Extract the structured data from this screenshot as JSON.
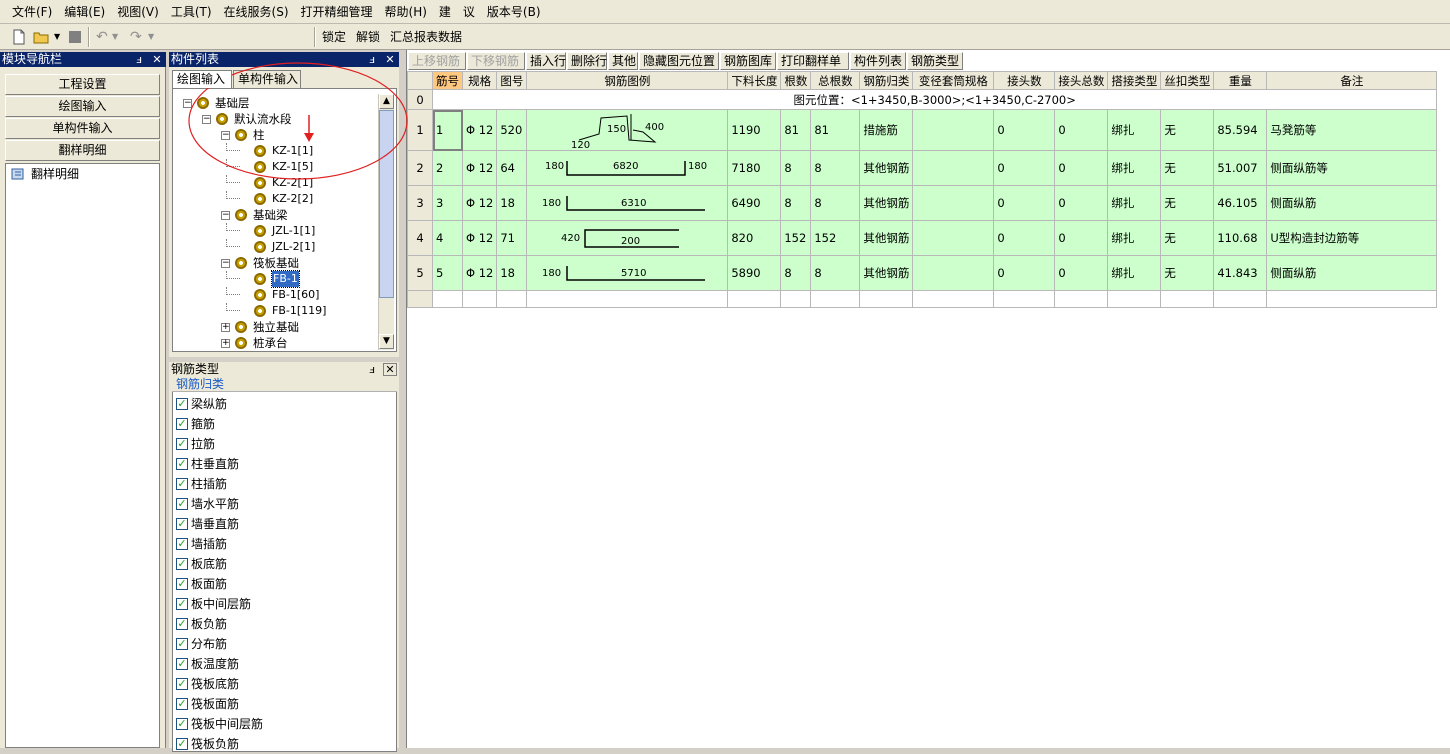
{
  "menu": [
    "文件(F)",
    "编辑(E)",
    "视图(V)",
    "工具(T)",
    "在线服务(S)",
    "打开精细管理",
    "帮助(H)",
    "建　议",
    "版本号(B)"
  ],
  "toolbar": {
    "lock": "锁定",
    "unlock": "解锁",
    "summary": "汇总报表数据"
  },
  "nav": {
    "title": "模块导航栏",
    "buttons": [
      "工程设置",
      "绘图输入",
      "单构件输入",
      "翻样明细"
    ],
    "tree_item": "翻样明细"
  },
  "component_list": {
    "title": "构件列表",
    "tabs": [
      "绘图输入",
      "单构件输入"
    ],
    "tree": [
      {
        "label": "基础层",
        "level": 0,
        "exp": "−"
      },
      {
        "label": "默认流水段",
        "level": 1,
        "exp": "−"
      },
      {
        "label": "柱",
        "level": 2,
        "exp": "−"
      },
      {
        "label": "KZ-1[1]",
        "level": 3
      },
      {
        "label": "KZ-1[5]",
        "level": 3
      },
      {
        "label": "KZ-2[1]",
        "level": 3
      },
      {
        "label": "KZ-2[2]",
        "level": 3
      },
      {
        "label": "基础梁",
        "level": 2,
        "exp": "−"
      },
      {
        "label": "JZL-1[1]",
        "level": 3
      },
      {
        "label": "JZL-2[1]",
        "level": 3
      },
      {
        "label": "筏板基础",
        "level": 2,
        "exp": "−"
      },
      {
        "label": "FB-1",
        "level": 3,
        "selected": true
      },
      {
        "label": "FB-1[60]",
        "level": 3
      },
      {
        "label": "FB-1[119]",
        "level": 3
      },
      {
        "label": "独立基础",
        "level": 2,
        "exp": "+"
      },
      {
        "label": "桩承台",
        "level": 2,
        "exp": "+"
      }
    ]
  },
  "rebar_types": {
    "title": "钢筋类型",
    "group": "钢筋归类",
    "items": [
      "梁纵筋",
      "箍筋",
      "拉筋",
      "柱垂直筋",
      "柱插筋",
      "墙水平筋",
      "墙垂直筋",
      "墙插筋",
      "板底筋",
      "板面筋",
      "板中间层筋",
      "板负筋",
      "分布筋",
      "板温度筋",
      "筏板底筋",
      "筏板面筋",
      "筏板中间层筋",
      "筏板负筋"
    ]
  },
  "grid_toolbar": {
    "buttons": [
      "上移钢筋",
      "下移钢筋",
      "插入行",
      "删除行",
      "其他",
      "隐藏图元位置",
      "钢筋图库",
      "打印翻样单",
      "构件列表",
      "钢筋类型"
    ],
    "disabled": [
      true,
      true,
      false,
      false,
      false,
      false,
      false,
      false,
      false,
      false
    ]
  },
  "grid": {
    "headers": [
      "筋号",
      "规格",
      "图号",
      "钢筋图例",
      "下料长度",
      "根数",
      "总根数",
      "钢筋归类",
      "变径套筒规格",
      "接头数",
      "接头总数",
      "搭接类型",
      "丝扣类型",
      "重量",
      "备注"
    ],
    "position_text": "图元位置：<1+3450,B-3000>;<1+3450,C-2700>",
    "rows": [
      {
        "no": "1",
        "jh": "1",
        "spec": "Φ 12",
        "fig": "520",
        "len": "1190",
        "n": "81",
        "total": "81",
        "cat": "措施筋",
        "sleeve": "",
        "joints": "0",
        "jtotal": "0",
        "lap": "绑扎",
        "thread": "无",
        "weight": "85.594",
        "note": "马凳筋等",
        "shape": {
          "a": "120",
          "b": "150",
          "c": "400"
        }
      },
      {
        "no": "2",
        "jh": "2",
        "spec": "Φ 12",
        "fig": "64",
        "len": "7180",
        "n": "8",
        "total": "8",
        "cat": "其他钢筋",
        "sleeve": "",
        "joints": "0",
        "jtotal": "0",
        "lap": "绑扎",
        "thread": "无",
        "weight": "51.007",
        "note": "侧面纵筋等",
        "shape": {
          "l": "180",
          "m": "6820",
          "r": "180"
        }
      },
      {
        "no": "3",
        "jh": "3",
        "spec": "Φ 12",
        "fig": "18",
        "len": "6490",
        "n": "8",
        "total": "8",
        "cat": "其他钢筋",
        "sleeve": "",
        "joints": "0",
        "jtotal": "0",
        "lap": "绑扎",
        "thread": "无",
        "weight": "46.105",
        "note": "侧面纵筋",
        "shape": {
          "l": "180",
          "m": "6310"
        }
      },
      {
        "no": "4",
        "jh": "4",
        "spec": "Φ 12",
        "fig": "71",
        "len": "820",
        "n": "152",
        "total": "152",
        "cat": "其他钢筋",
        "sleeve": "",
        "joints": "0",
        "jtotal": "0",
        "lap": "绑扎",
        "thread": "无",
        "weight": "110.68",
        "note": "U型构造封边筋等",
        "shape": {
          "l": "420",
          "m": "200"
        }
      },
      {
        "no": "5",
        "jh": "5",
        "spec": "Φ 12",
        "fig": "18",
        "len": "5890",
        "n": "8",
        "total": "8",
        "cat": "其他钢筋",
        "sleeve": "",
        "joints": "0",
        "jtotal": "0",
        "lap": "绑扎",
        "thread": "无",
        "weight": "41.843",
        "note": "侧面纵筋",
        "shape": {
          "l": "180",
          "m": "5710"
        }
      }
    ],
    "position_row_label": "0"
  },
  "colors": {
    "title_bar": "#0a246a",
    "row_green": "#ccffcc",
    "annotation": "#e02020",
    "header_highlight": "#ffc880"
  }
}
